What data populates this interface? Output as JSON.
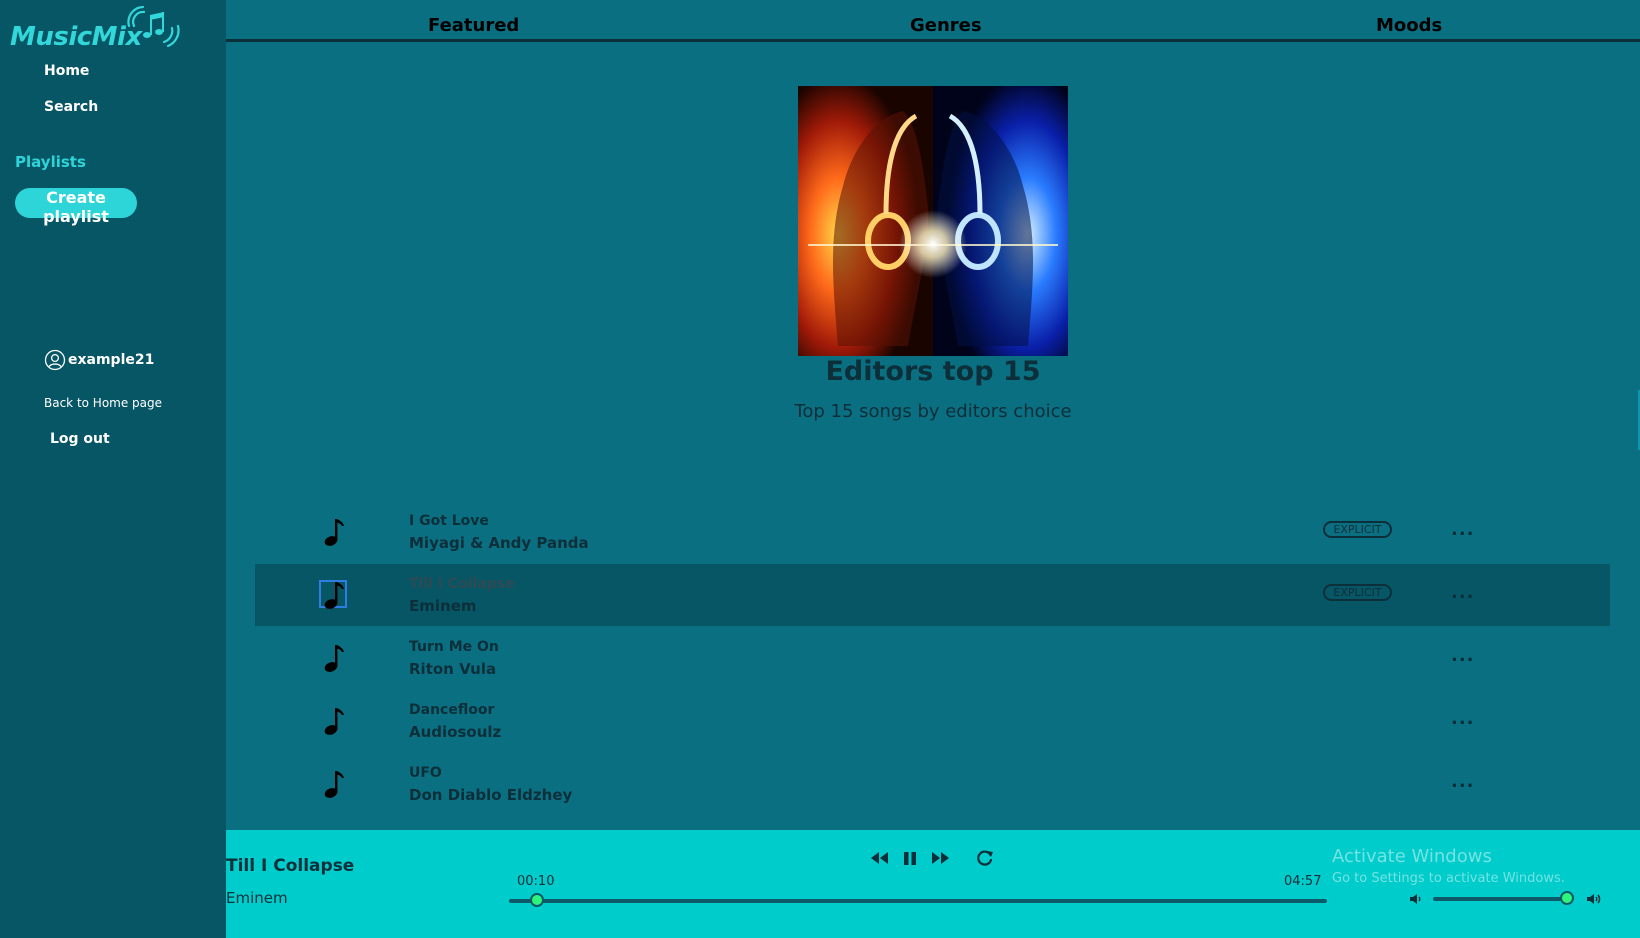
{
  "app": {
    "name": "MusicMix"
  },
  "sidebar": {
    "nav": [
      {
        "label": "Home"
      },
      {
        "label": "Search"
      }
    ],
    "playlists_label": "Playlists",
    "create_playlist_label": "Create playlist",
    "username": "example21",
    "back_home_label": "Back to Home page",
    "logout_label": "Log out"
  },
  "tabs": [
    {
      "label": "Featured"
    },
    {
      "label": "Genres"
    },
    {
      "label": "Moods"
    }
  ],
  "playlist": {
    "title": "Editors top 15",
    "subtitle": "Top 15 songs by editors choice",
    "cover_description": "two glowing faces with headphones, orange and blue"
  },
  "tracks": [
    {
      "title": "I Got Love",
      "artist": "Miyagi & Andy Panda",
      "explicit": "EXPLICIT",
      "more": "..."
    },
    {
      "title": "Till I Collapse",
      "artist": "Eminem",
      "explicit": "EXPLICIT",
      "more": "...",
      "active": true
    },
    {
      "title": "Turn Me On",
      "artist": "Riton  Vula",
      "more": "..."
    },
    {
      "title": "Dancefloor",
      "artist": "Audiosoulz",
      "more": "..."
    },
    {
      "title": "UFO",
      "artist": "Don Diablo  Eldzhey",
      "more": "..."
    }
  ],
  "player": {
    "now_playing_title": "Till I Collapse",
    "now_playing_artist": "Eminem",
    "current_time": "00:10",
    "total_time": "04:57",
    "progress_fraction": 0.034,
    "volume_fraction": 0.96
  },
  "watermark": {
    "line1": "Activate Windows",
    "line2": "Go to Settings to activate Windows."
  },
  "colors": {
    "background": "#0b6f82",
    "sidebar": "#075666",
    "accent": "#2ed5d8",
    "player_bar": "#00cccc",
    "active_row": "#075666",
    "slider_thumb": "#2cf57b"
  }
}
